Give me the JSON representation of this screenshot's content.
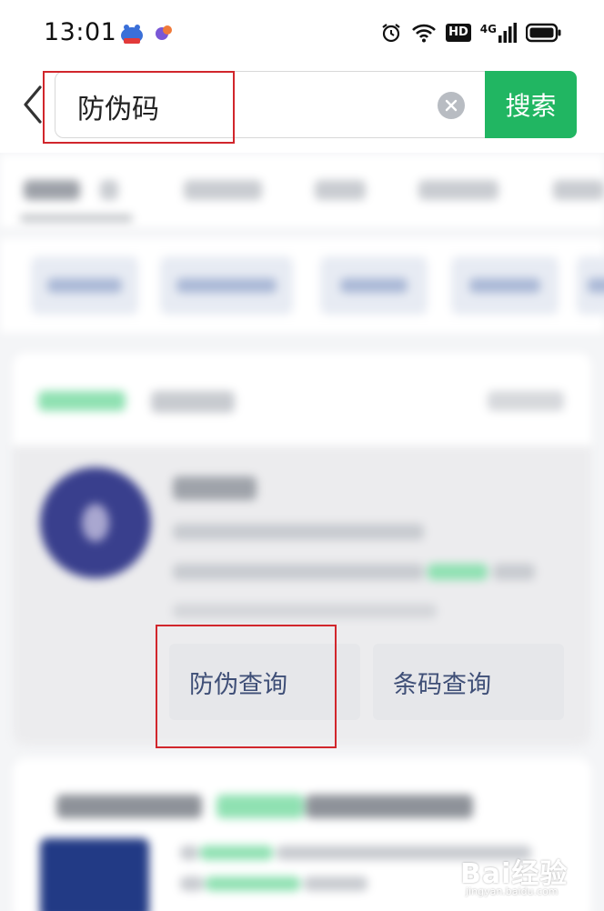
{
  "status_bar": {
    "time": "13:01",
    "hd_label": "HD",
    "network_label": "4G",
    "icons": [
      "baidu-app-icon",
      "notification-app-icon",
      "alarm-icon",
      "wifi-icon",
      "hd-icon",
      "signal-icon",
      "battery-icon"
    ]
  },
  "search": {
    "query": "防伪码",
    "button_label": "搜索",
    "accent_color": "#21b662"
  },
  "result_card": {
    "actions": [
      "防伪查询",
      "条码查询"
    ]
  },
  "highlight_color": "#d1262c",
  "watermark": {
    "main": "Bai经验",
    "sub": "jingyan.baidu.com"
  }
}
